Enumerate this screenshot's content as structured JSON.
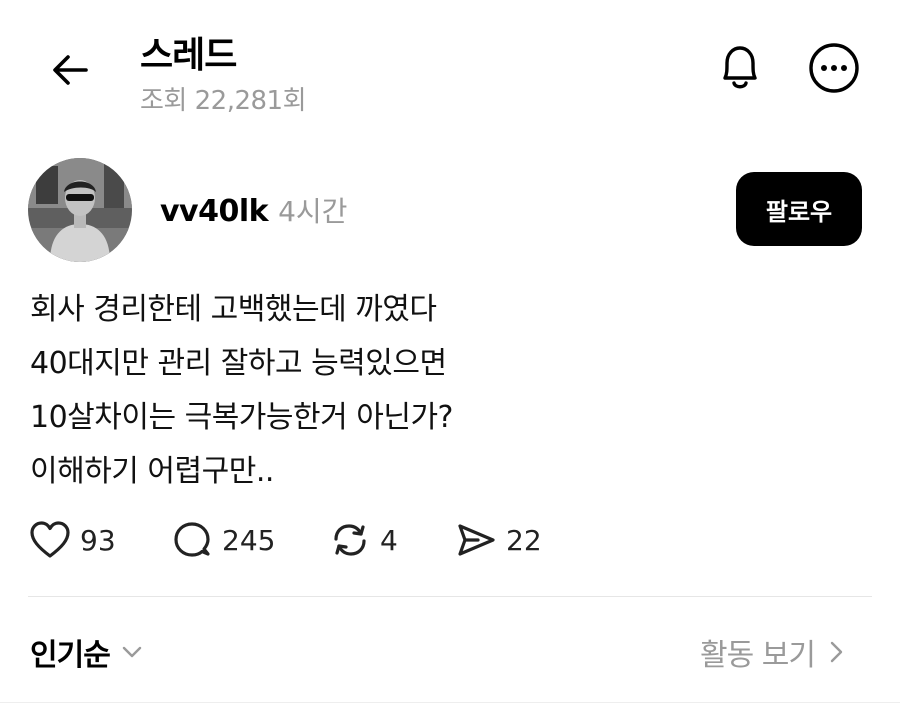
{
  "header": {
    "title": "스레드",
    "views": "조회 22,281회",
    "back_icon": "arrow-left-icon",
    "bell_icon": "bell-icon",
    "more_icon": "more-horizontal-circle-icon"
  },
  "post": {
    "username": "vv40lk",
    "time": "4시간",
    "follow_label": "팔로우",
    "lines": [
      "회사 경리한테 고백했는데 까였다",
      "40대지만 관리 잘하고 능력있으면",
      "10살차이는 극복가능한거 아닌가?",
      "이해하기 어렵구만.."
    ],
    "likes": "93",
    "replies": "245",
    "reposts": "4",
    "shares": "22"
  },
  "footer": {
    "sort_label": "인기순",
    "activity_label": "활동 보기"
  },
  "colors": {
    "text": "#000000",
    "muted": "#9a9a9a",
    "button_bg": "#000000",
    "button_text": "#ffffff",
    "divider": "#e6e6e6"
  }
}
